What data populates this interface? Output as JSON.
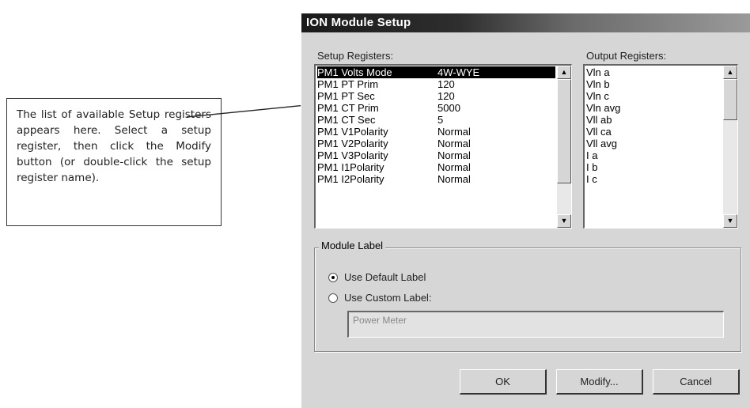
{
  "callout": {
    "text": "The list of available Setup registers appears here. Select a setup register, then click the Modify button (or double-click the setup register name)."
  },
  "dialog": {
    "title": "ION Module Setup",
    "setup_registers_label": "Setup Registers:",
    "output_registers_label": "Output Registers:",
    "setup_registers": [
      {
        "name": "PM1 Volts Mode",
        "value": "4W-WYE",
        "selected": true
      },
      {
        "name": "PM1 PT Prim",
        "value": "120"
      },
      {
        "name": "PM1 PT Sec",
        "value": "120"
      },
      {
        "name": "PM1 CT Prim",
        "value": "5000"
      },
      {
        "name": "PM1 CT Sec",
        "value": "5"
      },
      {
        "name": "PM1 V1Polarity",
        "value": "Normal"
      },
      {
        "name": "PM1 V2Polarity",
        "value": "Normal"
      },
      {
        "name": "PM1 V3Polarity",
        "value": "Normal"
      },
      {
        "name": "PM1 I1Polarity",
        "value": "Normal"
      },
      {
        "name": "PM1 I2Polarity",
        "value": "Normal"
      }
    ],
    "output_registers": [
      "Vln a",
      "Vln b",
      "Vln c",
      "Vln avg",
      "Vll ab",
      "Vll ca",
      "Vll avg",
      "I a",
      "I b",
      "I c"
    ],
    "module_label": {
      "title": "Module Label",
      "default_option": "Use Default Label",
      "custom_option": "Use Custom Label:",
      "selected": "default",
      "custom_value": "Power Meter"
    },
    "buttons": {
      "ok": "OK",
      "modify": "Modify...",
      "cancel": "Cancel"
    }
  },
  "icons": {
    "scroll_up": "up-arrow-icon",
    "scroll_down": "down-arrow-icon"
  }
}
